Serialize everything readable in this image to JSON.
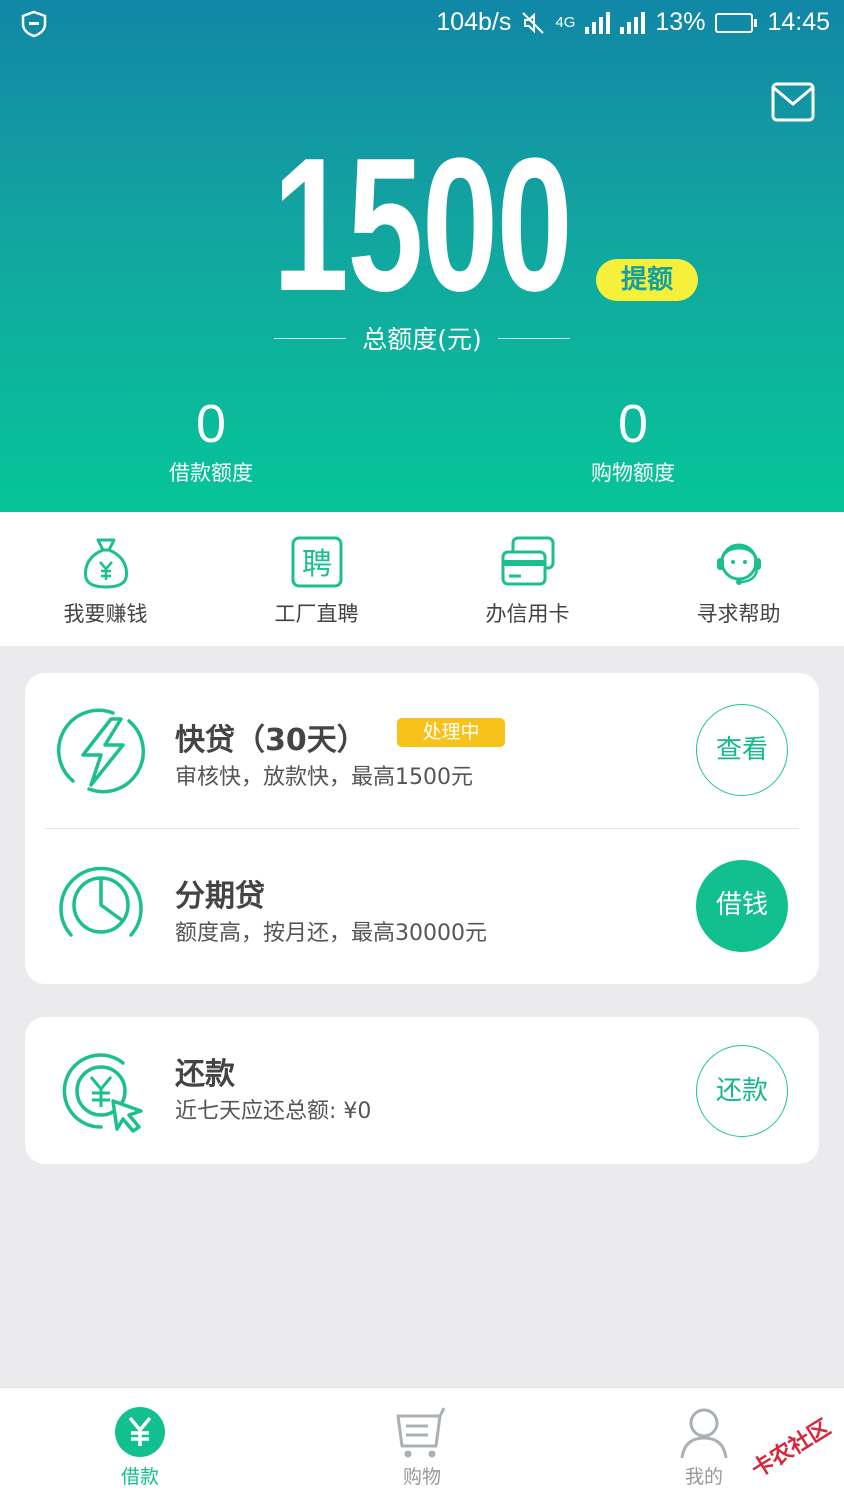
{
  "status_bar": {
    "speed": "104b/s",
    "network": "4G",
    "battery": "13%",
    "battery_level": 0.13,
    "time": "14:45"
  },
  "hero": {
    "total_amount": "1500",
    "raise_button": "提额",
    "total_label": "总额度(元)",
    "loan_quota_value": "0",
    "loan_quota_label": "借款额度",
    "shopping_quota_value": "0",
    "shopping_quota_label": "购物额度"
  },
  "quick_menu": [
    {
      "label": "我要赚钱",
      "icon": "money-bag-icon"
    },
    {
      "label": "工厂直聘",
      "icon": "recruit-icon"
    },
    {
      "label": "办信用卡",
      "icon": "credit-card-icon"
    },
    {
      "label": "寻求帮助",
      "icon": "customer-service-icon"
    }
  ],
  "products": [
    {
      "title": "快贷（30天）",
      "status": "处理中",
      "desc": "审核快，放款快，最高1500元",
      "button": "查看",
      "icon": "lightning-icon"
    },
    {
      "title": "分期贷",
      "desc": "额度高，按月还，最高30000元",
      "button": "借钱",
      "icon": "pie-chart-icon"
    }
  ],
  "repay": {
    "title": "还款",
    "desc": "近七天应还总额: ¥0",
    "button": "还款",
    "icon": "yuan-cursor-icon"
  },
  "bottom_nav": [
    {
      "label": "借款",
      "icon": "yuan-icon",
      "active": true
    },
    {
      "label": "购物",
      "icon": "cart-icon",
      "active": false
    },
    {
      "label": "我的",
      "icon": "user-icon",
      "active": false
    }
  ],
  "watermark": "卡农社区",
  "colors": {
    "accent": "#12c08f",
    "gradient_top": "#1187a6",
    "gradient_bottom": "#06c598",
    "badge_yellow": "#f7c21b"
  }
}
